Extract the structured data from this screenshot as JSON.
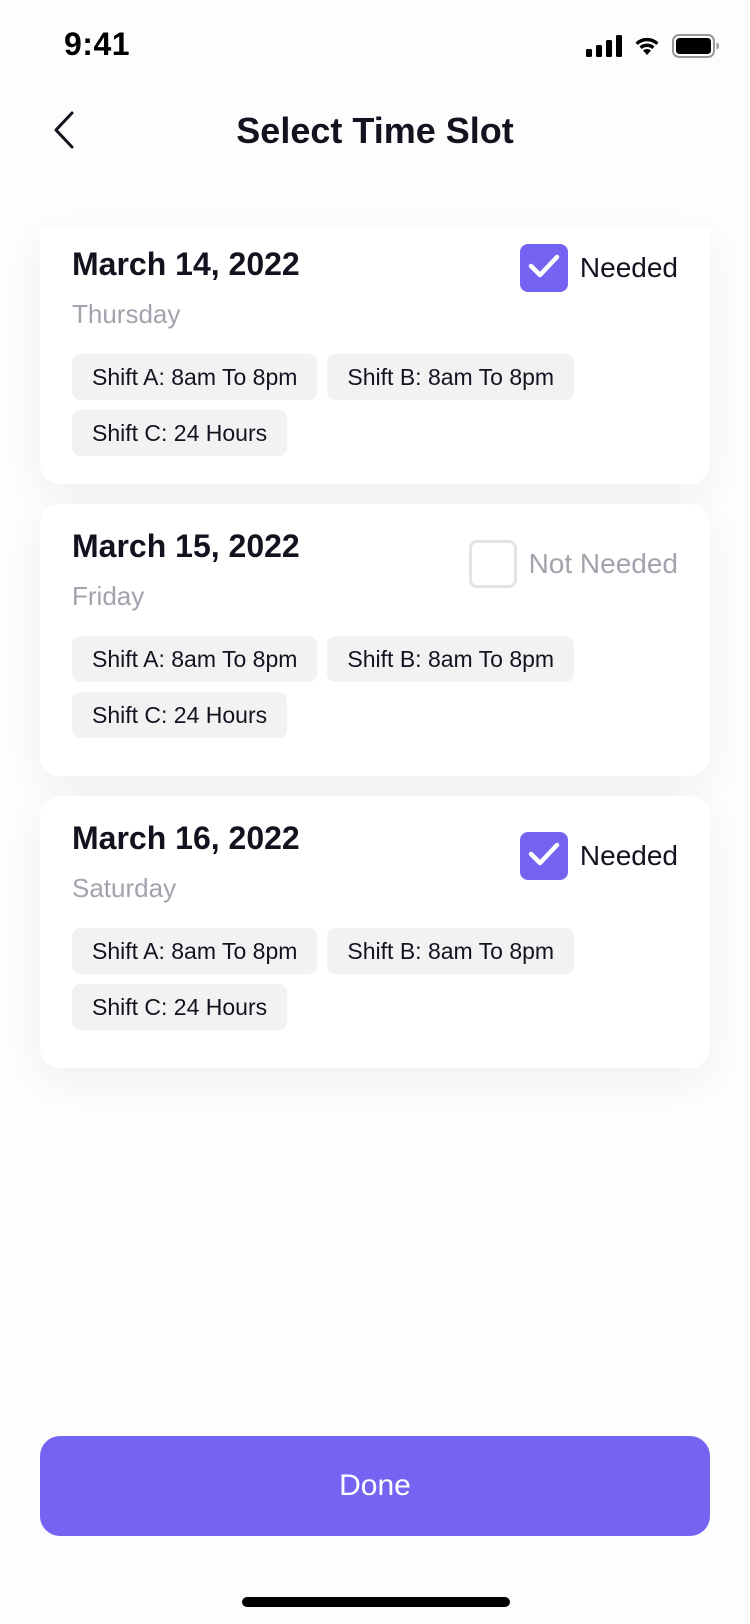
{
  "status_bar": {
    "time": "9:41",
    "icons": [
      "signal-icon",
      "wifi-icon",
      "battery-icon"
    ]
  },
  "header": {
    "back_icon": "chevron-left-icon",
    "title": "Select Time Slot"
  },
  "days": [
    {
      "date": "March 14, 2022",
      "weekday": "Thursday",
      "needed": true,
      "needed_label": "Needed",
      "shifts": [
        "Shift A: 8am To 8pm",
        "Shift B: 8am To 8pm",
        "Shift C: 24 Hours"
      ]
    },
    {
      "date": "March 15, 2022",
      "weekday": "Friday",
      "needed": false,
      "needed_label": "Not Needed",
      "shifts": [
        "Shift A: 8am To 8pm",
        "Shift B: 8am To 8pm",
        "Shift C: 24 Hours"
      ]
    },
    {
      "date": "March 16, 2022",
      "weekday": "Saturday",
      "needed": true,
      "needed_label": "Needed",
      "shifts": [
        "Shift A: 8am To 8pm",
        "Shift B: 8am To 8pm",
        "Shift C: 24 Hours"
      ]
    }
  ],
  "done_button": {
    "label": "Done"
  },
  "colors": {
    "accent": "#7464f1",
    "text": "#15121f",
    "muted": "#a3a3ad",
    "chip_bg": "#f2f2f3"
  }
}
